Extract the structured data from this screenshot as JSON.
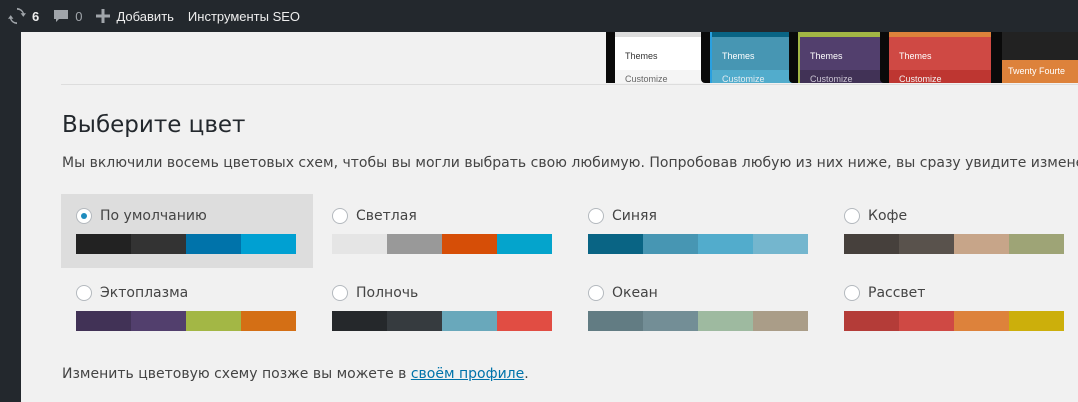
{
  "adminbar": {
    "updates_count": "6",
    "comments_count": "0",
    "add_label": "Добавить",
    "seo_label": "Инструменты SEO"
  },
  "preview": {
    "menu_title": "Themes",
    "menu_sub": "Customize",
    "last_label": "Twenty Fourte"
  },
  "section": {
    "heading": "Выберите цвет",
    "description": "Мы включили восемь цветовых схем, чтобы вы могли выбрать свою любимую. Попробовав любую из них ниже, вы сразу увидите изменения."
  },
  "schemes": [
    {
      "label": "По умолчанию",
      "selected": true,
      "colors": [
        "#222222",
        "#333333",
        "#0073aa",
        "#00a0d2"
      ]
    },
    {
      "label": "Светлая",
      "selected": false,
      "colors": [
        "#e5e5e5",
        "#999999",
        "#d64e07",
        "#04a4cc"
      ]
    },
    {
      "label": "Синяя",
      "selected": false,
      "colors": [
        "#096484",
        "#4796b3",
        "#52accc",
        "#74b6ce"
      ]
    },
    {
      "label": "Кофе",
      "selected": false,
      "colors": [
        "#46403c",
        "#59524c",
        "#c7a589",
        "#9ea476"
      ]
    },
    {
      "label": "Эктоплазма",
      "selected": false,
      "colors": [
        "#413256",
        "#523f6d",
        "#a3b745",
        "#d46f15"
      ]
    },
    {
      "label": "Полночь",
      "selected": false,
      "colors": [
        "#25282b",
        "#363b3f",
        "#69a8bb",
        "#e14d43"
      ]
    },
    {
      "label": "Океан",
      "selected": false,
      "colors": [
        "#627c83",
        "#738e96",
        "#9ebaa0",
        "#aa9d88"
      ]
    },
    {
      "label": "Рассвет",
      "selected": false,
      "colors": [
        "#b43c38",
        "#cf4944",
        "#dd823b",
        "#ccaf0b"
      ]
    }
  ],
  "footer": {
    "text_before": "Изменить цветовую схему позже вы можете в ",
    "link_text": "своём профиле",
    "text_after": "."
  }
}
